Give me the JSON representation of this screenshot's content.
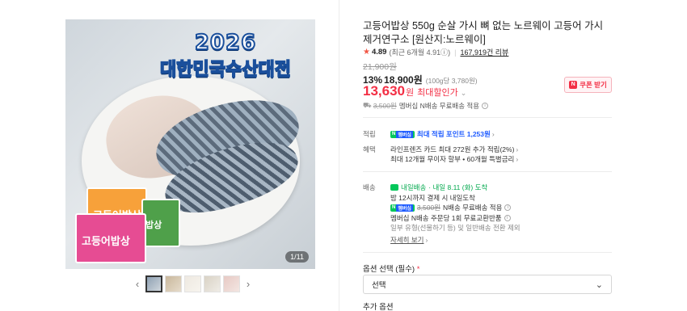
{
  "gallery": {
    "badge_year": "2026",
    "badge_title": "대한민국수산대전",
    "package_labels": [
      "고등어밥상",
      "밥상",
      "고등어밥상"
    ],
    "counter": "1/11",
    "prev_icon": "chevron-left-icon",
    "next_icon": "chevron-right-icon",
    "thumbnail_count": 5
  },
  "product": {
    "title": "고등어밥상 550g 순살 가시 뼈 없는 노르웨이 고등어 가시제거연구소 [원산지:노르웨이]",
    "rating_score": "4.89",
    "rating_recent": "(최근 6개월 4.91",
    "rating_info": "ⓘ)",
    "review_count": "167,919건 리뷰",
    "original_price": "21,900원",
    "discount_percent": "13%",
    "sale_price": "18,900원",
    "unit_price": "(100g당 3,780원)",
    "final_price": "13,630",
    "final_price_unit": "원",
    "max_discount_label": "최대할인가",
    "coupon_label": "쿠폰 받기",
    "delivery_struck": "3,500원",
    "delivery_note": "멤버십 N배송 무료배송 적용"
  },
  "benefits": {
    "points_label": "적립",
    "points_value": "최대 적립 포인트 1,253원",
    "perks_label": "혜택",
    "perk_1": "라인프렌즈 카드 최대 272원 추가 적립(2%)",
    "perk_2": "최대 12개월 무이자 할부 • 60개월 특별금리"
  },
  "shipping": {
    "label": "배송",
    "badge": "내일배송",
    "arrival": "· 내일 8.11 (화) 도착",
    "deadline": "밤 12시까지 결제 시 내일도착",
    "struck_fee": "3,500원",
    "free_note": "N배송 무료배송 적용",
    "exchange_note": "멤버십 N배송 주문당 1회 무료교환반품",
    "exception_note": "일부 유형(선물하기 등) 및 일반배송 전환 제외",
    "more_link": "자세히 보기"
  },
  "options": {
    "label": "옵션 선택 (필수)",
    "required_mark": "*",
    "select_value": "선택",
    "add_label": "추가 옵션"
  },
  "colors": {
    "accent_red": "#f32f45",
    "npay_green": "#03c75a",
    "point_blue": "#1e5bff"
  }
}
